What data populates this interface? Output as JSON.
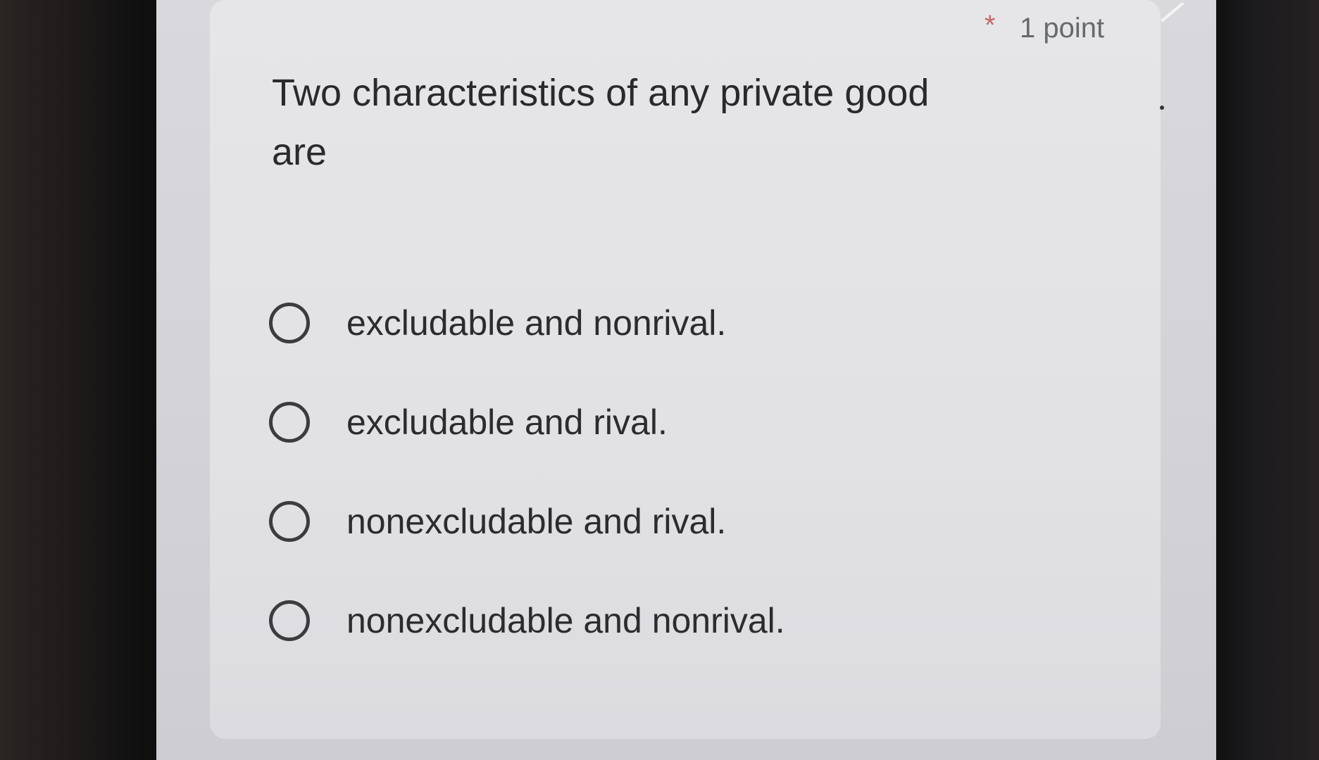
{
  "question": {
    "required_marker": "*",
    "points": "1 point",
    "line1": "Two characteristics of any private good",
    "line2": "are"
  },
  "options": [
    {
      "label": "excludable and nonrival.",
      "selected": false
    },
    {
      "label": "excludable and rival.",
      "selected": false
    },
    {
      "label": "nonexcludable and rival.",
      "selected": false
    },
    {
      "label": "nonexcludable and nonrival.",
      "selected": false
    }
  ],
  "colors": {
    "card_background": "#e4e4e6",
    "text": "#2a2a2c",
    "required_star": "#c46a6a",
    "points_text": "#666a6e",
    "radio_border": "#3c3c40"
  },
  "icons": {
    "radio": "radio-unchecked-icon"
  }
}
